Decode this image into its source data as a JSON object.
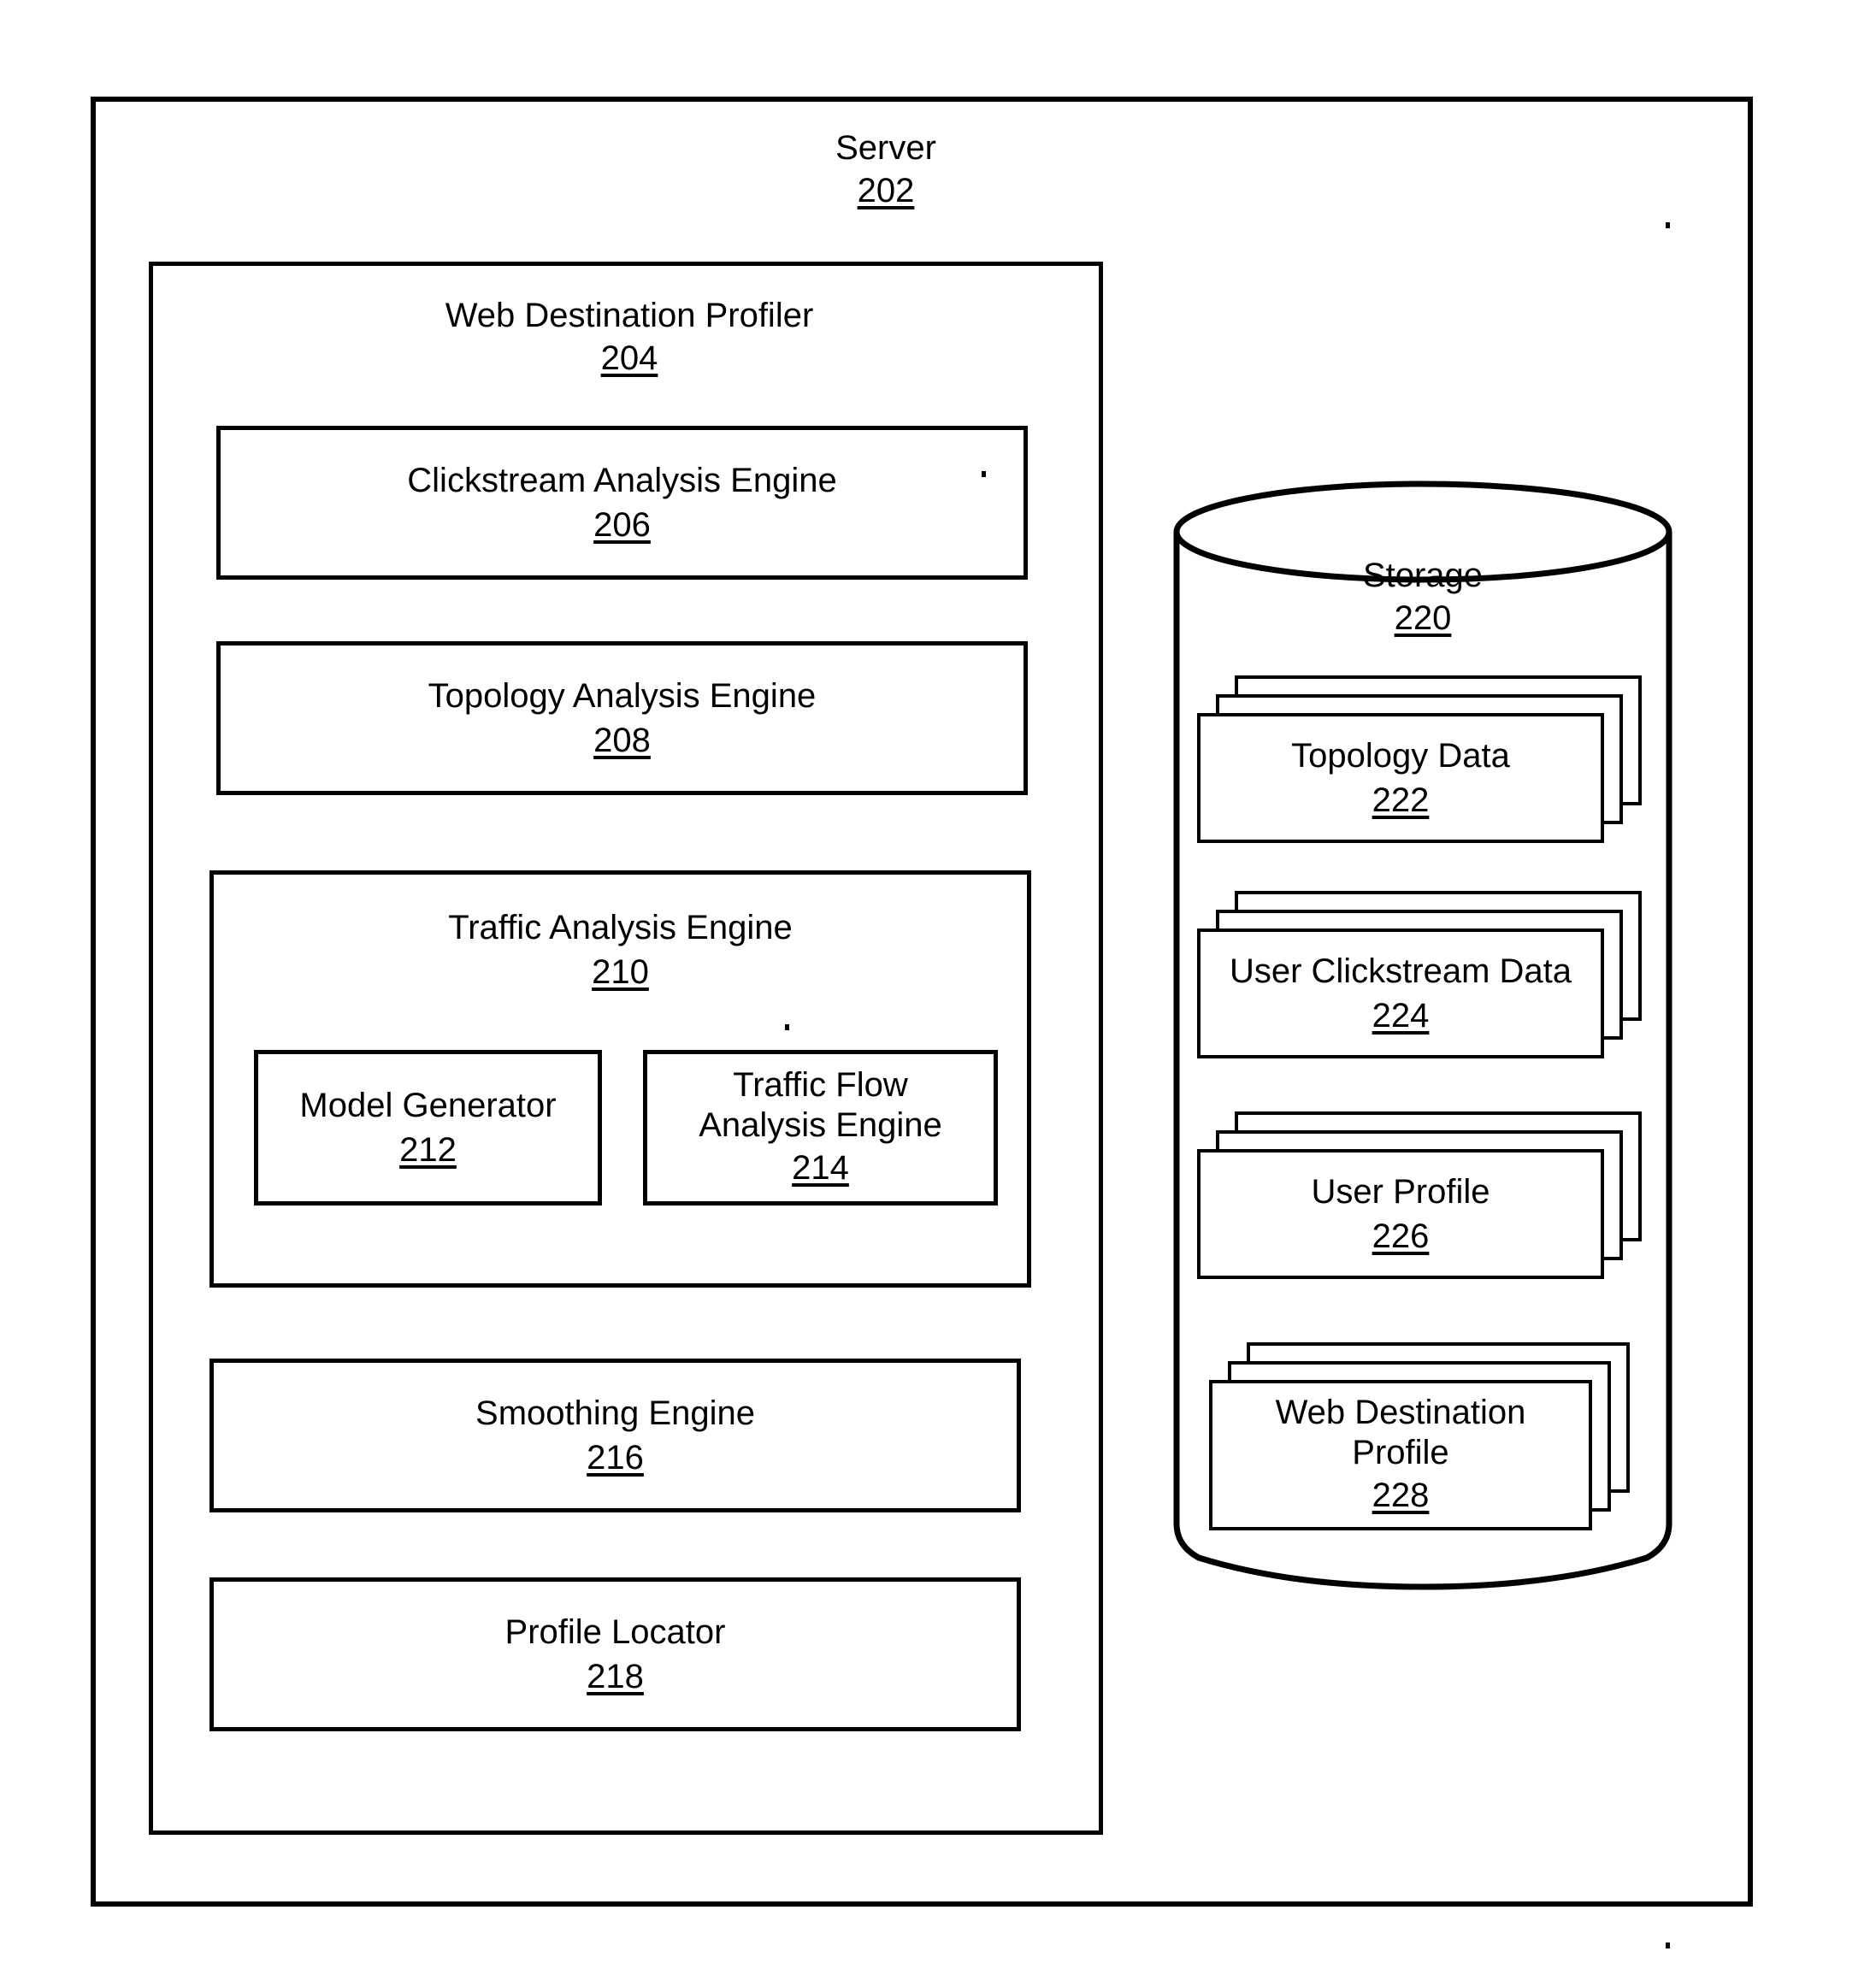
{
  "figure": {
    "server": {
      "title": "Server",
      "ref": "202"
    },
    "profiler": {
      "title": "Web Destination Profiler",
      "ref": "204",
      "engines": [
        {
          "title": "Clickstream Analysis Engine",
          "ref": "206"
        },
        {
          "title": "Topology Analysis Engine",
          "ref": "208"
        },
        {
          "title": "Traffic Analysis Engine",
          "ref": "210"
        },
        {
          "title": "Smoothing Engine",
          "ref": "216"
        },
        {
          "title": "Profile Locator",
          "ref": "218"
        }
      ],
      "traffic_sub_engines": [
        {
          "title": "Model Generator",
          "ref": "212"
        },
        {
          "title": "Traffic Flow Analysis Engine",
          "ref": "214"
        }
      ]
    },
    "storage": {
      "title": "Storage",
      "ref": "220",
      "items": [
        {
          "title": "Topology Data",
          "ref": "222"
        },
        {
          "title": "User Clickstream Data",
          "ref": "224"
        },
        {
          "title": "User Profile",
          "ref": "226"
        },
        {
          "title": "Web Destination Profile",
          "ref": "228"
        }
      ]
    },
    "colors": {
      "ink": "#000000",
      "paper": "#ffffff"
    }
  }
}
